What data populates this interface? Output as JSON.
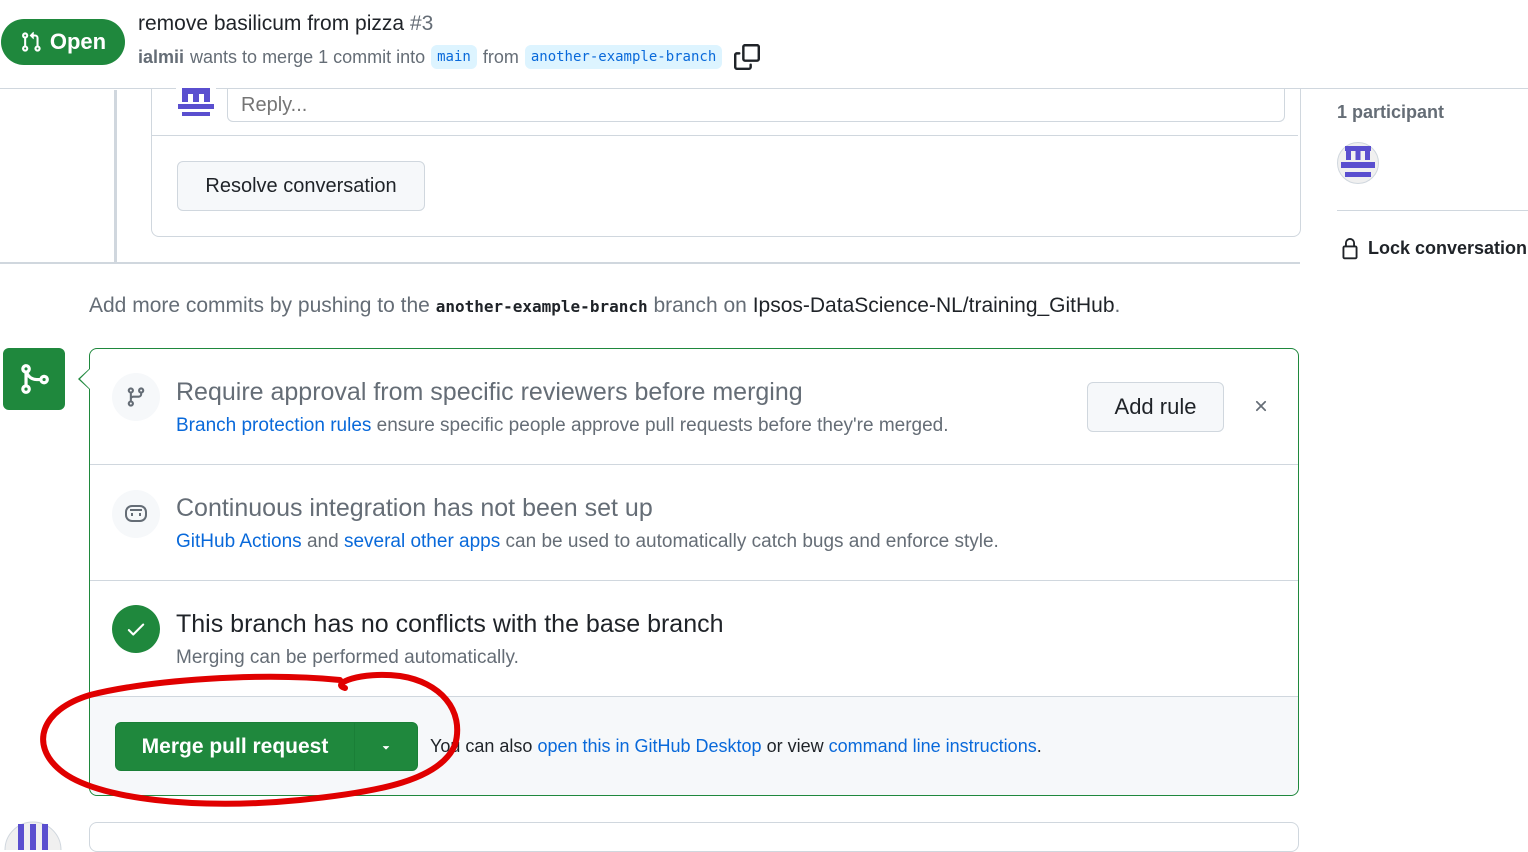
{
  "header": {
    "state_label": "Open",
    "title": "remove basilicum from pizza",
    "number": "#3",
    "author": "ialmii",
    "merge_text": "wants to merge 1 commit into",
    "base_branch": "main",
    "from_text": "from",
    "head_branch": "another-example-branch"
  },
  "thread": {
    "reply_placeholder": "Reply...",
    "resolve_label": "Resolve conversation"
  },
  "sidebar": {
    "participants_label": "1 participant",
    "lock_label": "Lock conversation"
  },
  "commit_hint": {
    "prefix": "Add more commits by pushing to the",
    "branch": "another-example-branch",
    "middle": "branch on",
    "repo": "Ipsos-DataScience-NL/training_GitHub",
    "suffix": "."
  },
  "merge_box": {
    "protection": {
      "title": "Require approval from specific reviewers before merging",
      "link": "Branch protection rules",
      "desc": "ensure specific people approve pull requests before they're merged.",
      "add_rule_label": "Add rule"
    },
    "ci": {
      "title": "Continuous integration has not been set up",
      "link1": "GitHub Actions",
      "and_text": "and",
      "link2": "several other apps",
      "desc": "can be used to automatically catch bugs and enforce style."
    },
    "conflicts": {
      "title": "This branch has no conflicts with the base branch",
      "desc": "Merging can be performed automatically."
    },
    "footer": {
      "merge_label": "Merge pull request",
      "text1": "You can also",
      "link1": "open this in GitHub Desktop",
      "text2": "or view",
      "link2": "command line instructions",
      "text3": "."
    }
  },
  "colors": {
    "green": "#1f883d",
    "link": "#0969da",
    "annotation_red": "#e00000"
  }
}
